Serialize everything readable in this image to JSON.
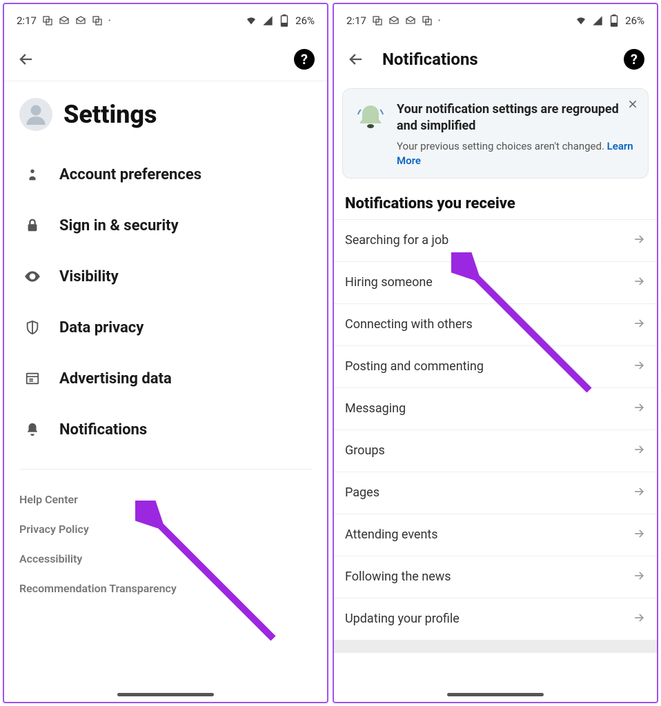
{
  "status": {
    "time": "2:17",
    "battery": "26%"
  },
  "left": {
    "title": "Settings",
    "items": [
      {
        "label": "Account preferences"
      },
      {
        "label": "Sign in & security"
      },
      {
        "label": "Visibility"
      },
      {
        "label": "Data privacy"
      },
      {
        "label": "Advertising data"
      },
      {
        "label": "Notifications"
      }
    ],
    "footer": [
      {
        "label": "Help Center"
      },
      {
        "label": "Privacy Policy"
      },
      {
        "label": "Accessibility"
      },
      {
        "label": "Recommendation Transparency"
      }
    ]
  },
  "right": {
    "title": "Notifications",
    "banner": {
      "title": "Your notification settings are regrouped and simplified",
      "body": "Your previous setting choices aren't changed.",
      "learn": "Learn More"
    },
    "section": "Notifications you receive",
    "items": [
      {
        "label": "Searching for a job"
      },
      {
        "label": "Hiring someone"
      },
      {
        "label": "Connecting with others"
      },
      {
        "label": "Posting and commenting"
      },
      {
        "label": "Messaging"
      },
      {
        "label": "Groups"
      },
      {
        "label": "Pages"
      },
      {
        "label": "Attending events"
      },
      {
        "label": "Following the news"
      },
      {
        "label": "Updating your profile"
      }
    ]
  }
}
